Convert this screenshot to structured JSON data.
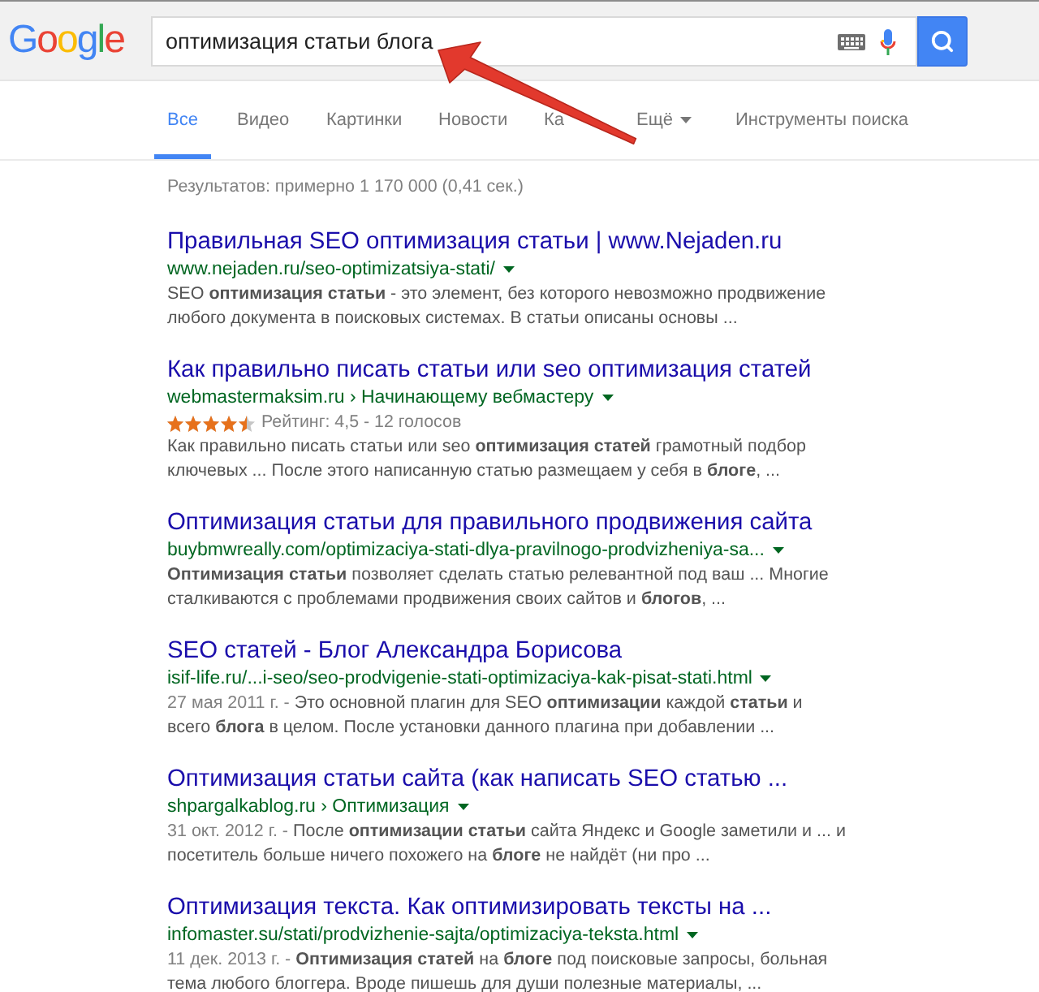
{
  "header": {
    "logo": "Google",
    "search": {
      "value": "оптимизация статьи блога"
    }
  },
  "tabs": [
    {
      "label": "Все",
      "selected": true,
      "kind": "tab"
    },
    {
      "label": "Видео",
      "selected": false,
      "kind": "tab"
    },
    {
      "label": "Картинки",
      "selected": false,
      "kind": "tab"
    },
    {
      "label": "Новости",
      "selected": false,
      "kind": "tab"
    },
    {
      "label": "Ка",
      "selected": false,
      "kind": "tab"
    },
    {
      "label": "Ещё",
      "selected": false,
      "kind": "menu"
    },
    {
      "label": "Инструменты поиска",
      "selected": false,
      "kind": "tools"
    }
  ],
  "result_stats": "Результатов: примерно 1 170 000 (0,41 сек.)",
  "results": [
    {
      "title": "Правильная SEO оптимизация статьи | www.Nejaden.ru",
      "url": "www.nejaden.ru/seo-optimizatsiya-stati/",
      "snippet": [
        "SEO **оптимизация статьи** - это элемент, без которого невозможно продвижение",
        "любого документа в поисковых системах. В статьи описаны основы ..."
      ]
    },
    {
      "title": "Как правильно писать статьи или seo оптимизация статей",
      "url": "webmastermaksim.ru › Начинающему вебмастеру",
      "rating": {
        "stars": 4.5,
        "text": "Рейтинг: 4,5 - 12 голосов"
      },
      "snippet": [
        "Как правильно писать статьи или seo **оптимизация статей** грамотный подбор",
        "ключевых ... После этого написанную статью размещаем у себя в **блоге**, ..."
      ]
    },
    {
      "title": "Оптимизация статьи для правильного продвижения сайта",
      "url": "buybmwreally.com/optimizaciya-stati-dlya-pravilnogo-prodvizheniya-sa...",
      "snippet": [
        "**Оптимизация статьи** позволяет сделать статью релевантной под ваш ... Многие",
        "сталкиваются с проблемами продвижения своих сайтов и **блогов**, ..."
      ]
    },
    {
      "title": "SEO статей - Блог Александра Борисова",
      "url": "isif-life.ru/...i-seo/seo-prodvigenie-stati-optimizaciya-kak-pisat-stati.html",
      "date": "27 мая 2011 г. -",
      "snippet": [
        "Это основной плагин для SEO **оптимизации** каждой **статьи** и",
        "всего **блога** в целом. После установки данного плагина при добавлении ..."
      ]
    },
    {
      "title": "Оптимизация статьи сайта (как написать SEO статью ...",
      "url": "shpargalkablog.ru › Оптимизация",
      "date": "31 окт. 2012 г. -",
      "snippet": [
        "После **оптимизации статьи** сайта Яндекс и Google заметили и ... и",
        "посетитель больше ничего похожего на **блоге** не найдёт (ни про ..."
      ]
    },
    {
      "title": "Оптимизация текста. Как оптимизировать тексты на ...",
      "url": "infomaster.su/stati/prodvizhenie-sajta/optimizaciya-teksta.html",
      "date": "11 дек. 2013 г. -",
      "snippet": [
        "**Оптимизация статей** на **блоге** под поисковые запросы, больная",
        "тема любого блоггера. Вроде пишешь для души полезные материалы, ..."
      ]
    }
  ]
}
